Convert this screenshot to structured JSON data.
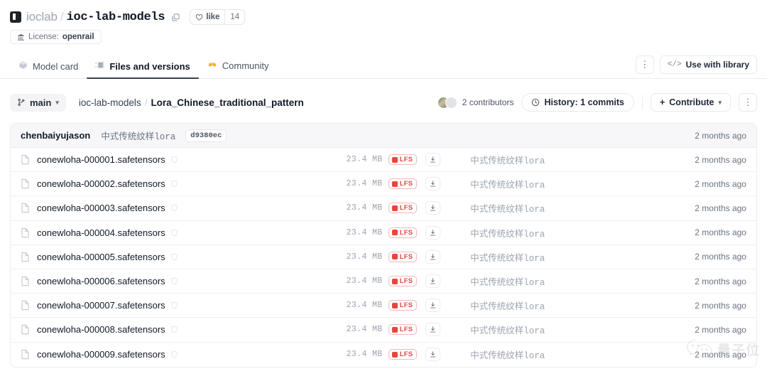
{
  "header": {
    "org": "ioclab",
    "separator": "/",
    "repo": "ioc-lab-models",
    "copy_icon": "copy-icon",
    "like_label": "like",
    "like_count": "14",
    "license_label": "License:",
    "license_value": "openrail"
  },
  "tabs": [
    {
      "label": "Model card",
      "icon": "cube-icon",
      "active": false
    },
    {
      "label": "Files and versions",
      "icon": "file-list-icon",
      "active": true
    },
    {
      "label": "Community",
      "icon": "handshake-icon",
      "active": false
    }
  ],
  "tabs_right": {
    "more_label": "⋮",
    "use_with_library": "Use with library",
    "code_icon": "</>"
  },
  "toolbar": {
    "branch": "main",
    "breadcrumb_root": "ioc-lab-models",
    "breadcrumb_sep": "/",
    "breadcrumb_current": "Lora_Chinese_traditional_pattern",
    "contributors": "2 contributors",
    "history": "History: 1 commits",
    "contribute": "Contribute",
    "more_label": "⋮"
  },
  "commit": {
    "author": "chenbaiyujason",
    "message": "中式传统纹样lora",
    "sha": "d9380ec",
    "time": "2 months ago"
  },
  "files": [
    {
      "name": "conewloha-000001.safetensors",
      "size": "23.4 MB",
      "lfs": "LFS",
      "message": "中式传统纹样lora",
      "time": "2 months ago"
    },
    {
      "name": "conewloha-000002.safetensors",
      "size": "23.4 MB",
      "lfs": "LFS",
      "message": "中式传统纹样lora",
      "time": "2 months ago"
    },
    {
      "name": "conewloha-000003.safetensors",
      "size": "23.4 MB",
      "lfs": "LFS",
      "message": "中式传统纹样lora",
      "time": "2 months ago"
    },
    {
      "name": "conewloha-000004.safetensors",
      "size": "23.4 MB",
      "lfs": "LFS",
      "message": "中式传统纹样lora",
      "time": "2 months ago"
    },
    {
      "name": "conewloha-000005.safetensors",
      "size": "23.4 MB",
      "lfs": "LFS",
      "message": "中式传统纹样lora",
      "time": "2 months ago"
    },
    {
      "name": "conewloha-000006.safetensors",
      "size": "23.4 MB",
      "lfs": "LFS",
      "message": "中式传统纹样lora",
      "time": "2 months ago"
    },
    {
      "name": "conewloha-000007.safetensors",
      "size": "23.4 MB",
      "lfs": "LFS",
      "message": "中式传统纹样lora",
      "time": "2 months ago"
    },
    {
      "name": "conewloha-000008.safetensors",
      "size": "23.4 MB",
      "lfs": "LFS",
      "message": "中式传统纹样lora",
      "time": "2 months ago"
    },
    {
      "name": "conewloha-000009.safetensors",
      "size": "23.4 MB",
      "lfs": "LFS",
      "message": "中式传统纹样lora",
      "time": "2 months ago"
    }
  ],
  "watermark": {
    "text": "量子位",
    "icon": "wechat-icon"
  },
  "colors": {
    "lfs_red": "#e8453c",
    "active_tab_underline": "#374151",
    "community_icon": "#f7b733"
  }
}
